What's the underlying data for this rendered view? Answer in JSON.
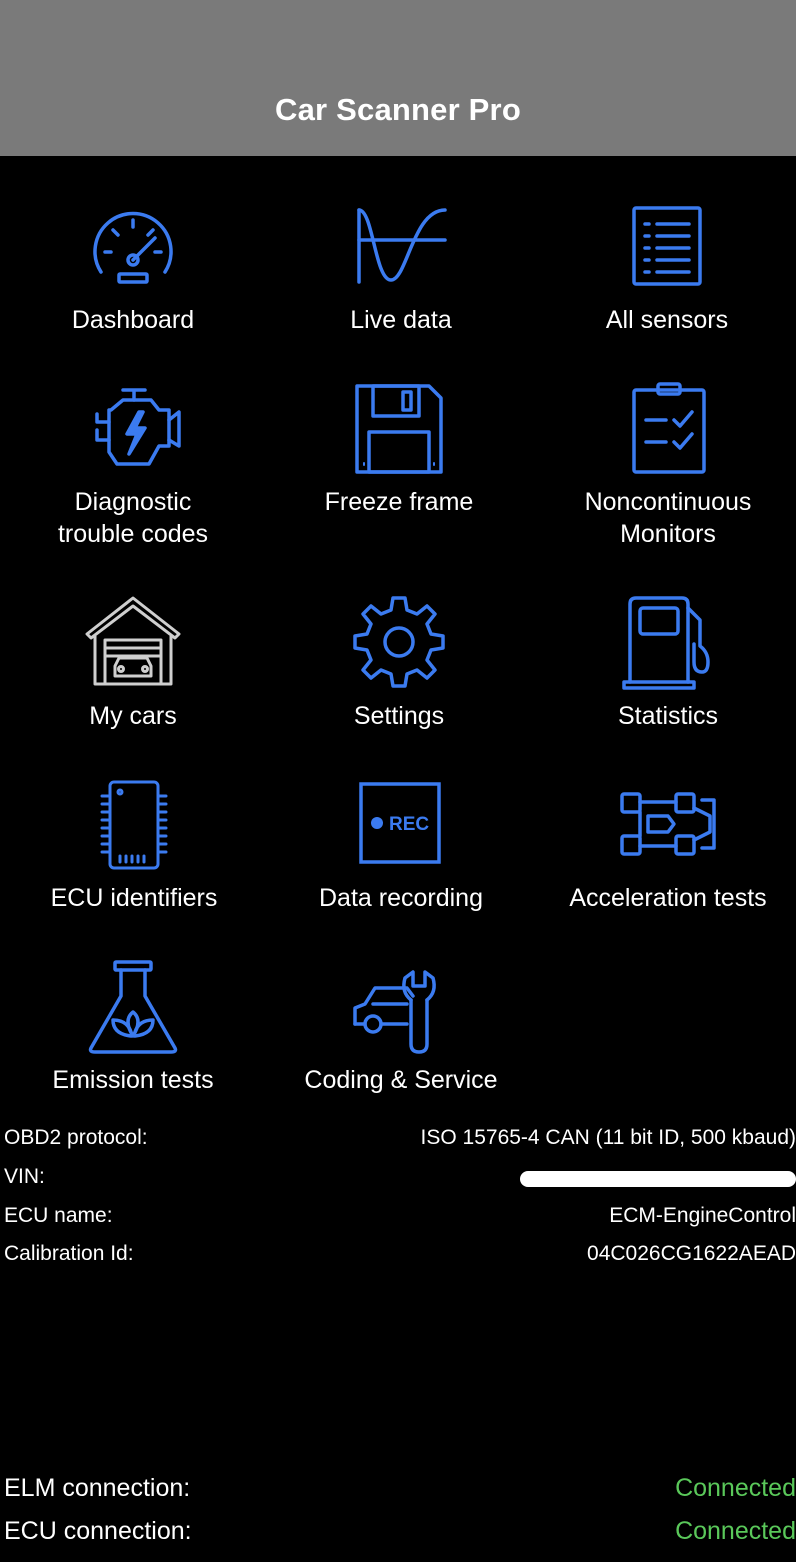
{
  "header": {
    "title": "Car Scanner Pro"
  },
  "menu": {
    "dashboard": "Dashboard",
    "live_data": "Live data",
    "all_sensors": "All sensors",
    "dtc": "Diagnostic\ntrouble codes",
    "freeze_frame": "Freeze frame",
    "noncontinuous": "Noncontinuous\nMonitors",
    "my_cars": "My cars",
    "settings": "Settings",
    "statistics": "Statistics",
    "ecu_identifiers": "ECU identifiers",
    "data_recording": "Data recording",
    "rec_badge": "REC",
    "acceleration": "Acceleration tests",
    "emission": "Emission tests",
    "coding": "Coding & Service"
  },
  "info": {
    "protocol_label": "OBD2 protocol:",
    "protocol_value": "ISO 15765-4 CAN (11 bit ID, 500 kbaud)",
    "vin_label": "VIN:",
    "ecu_name_label": "ECU name:",
    "ecu_name_value": "ECM-EngineControl",
    "calibration_label": "Calibration Id:",
    "calibration_value": "04C026CG1622AEAD"
  },
  "connection": {
    "elm_label": "ELM connection:",
    "elm_value": "Connected",
    "ecu_label": "ECU connection:",
    "ecu_value": "Connected"
  },
  "colors": {
    "accent": "#3b7bf0",
    "header_bg": "#7a7a7a",
    "connected": "#5ac85a",
    "my_cars_icon": "#cfcfcf"
  }
}
